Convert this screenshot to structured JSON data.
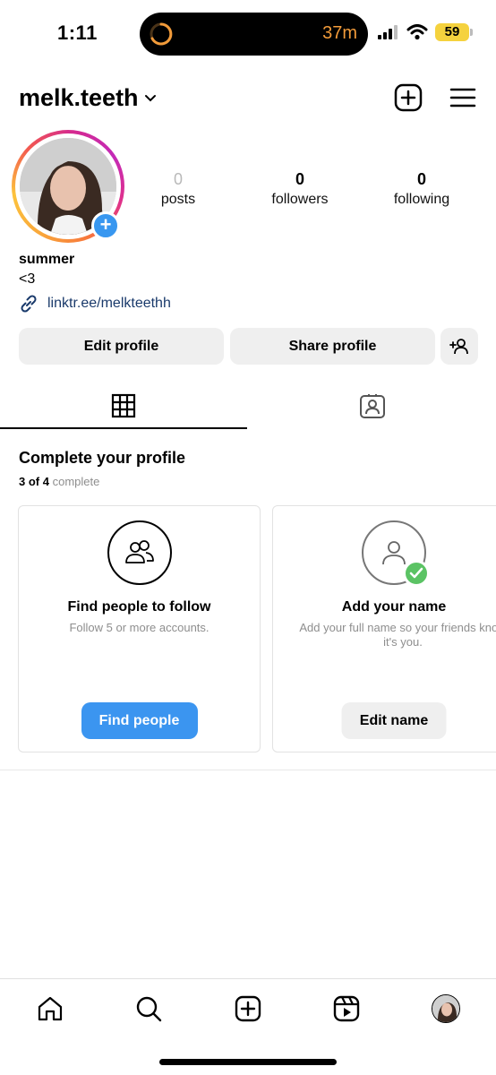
{
  "status_bar": {
    "time": "1:11",
    "timer": "37m",
    "battery": "59",
    "accent_color": "#f29b3a"
  },
  "header": {
    "username": "melk.teeth",
    "icons": [
      "chevron-down-icon",
      "new-post-icon",
      "menu-icon"
    ]
  },
  "profile": {
    "stats": [
      {
        "value": "0",
        "label": "posts"
      },
      {
        "value": "0",
        "label": "followers"
      },
      {
        "value": "0",
        "label": "following"
      }
    ],
    "name": "summer",
    "bio": "<3",
    "link": "linktr.ee/melkteethh",
    "buttons": {
      "edit": "Edit profile",
      "share": "Share profile"
    }
  },
  "tabs": [
    {
      "icon": "grid-icon",
      "active": true
    },
    {
      "icon": "tagged-icon",
      "active": false
    }
  ],
  "complete_profile": {
    "title": "Complete your profile",
    "progress_done": "3 of 4",
    "progress_word": "complete",
    "cards": [
      {
        "title": "Find people to follow",
        "desc": "Follow 5 or more accounts.",
        "button": "Find people",
        "icon": "people-icon",
        "done": false
      },
      {
        "title": "Add your name",
        "desc": "Add your full name so your friends know it's you.",
        "button": "Edit name",
        "icon": "person-icon",
        "done": true
      }
    ]
  },
  "bottom_nav": [
    "home-icon",
    "search-icon",
    "create-icon",
    "reels-icon",
    "profile-avatar"
  ],
  "colors": {
    "primary_blue": "#3b95f0",
    "check_green": "#5bc364",
    "link_color": "#1a3a6b"
  }
}
